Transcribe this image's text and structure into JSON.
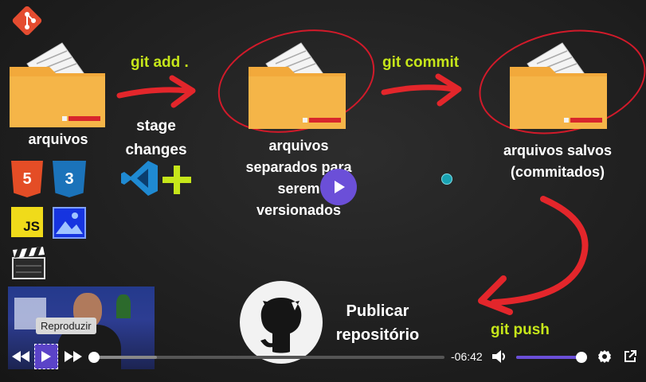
{
  "slide": {
    "label_arquivos": "arquivos",
    "git_add": "git add .",
    "stage_line1": "stage",
    "stage_line2": "changes",
    "separados_line1": "arquivos",
    "separados_line2": "separados para",
    "separados_line3": "serem",
    "separados_line4": "versionados",
    "git_commit": "git commit",
    "salvos_line1": "arquivos salvos",
    "salvos_line2": "(commitados)",
    "publicar_line1": "Publicar",
    "publicar_line2": "repositório",
    "git_push": "git push",
    "html_badge": "5",
    "css_badge": "3",
    "js_badge": "JS"
  },
  "colors": {
    "folder": "#f2a93b",
    "folder_shadow": "#d98e22",
    "red_arrow": "#e3262b",
    "accent_green": "#c6e61a",
    "player_purple": "#6a5acd",
    "play_button": "#6b4fd8"
  },
  "player": {
    "tooltip": "Reproduzir",
    "time_remaining": "-06:42",
    "progress": 0.0,
    "buffered": 0.18,
    "volume": 1.0
  },
  "icons": [
    "git-logo-icon",
    "html5-icon",
    "css3-icon",
    "js-icon",
    "image-icon",
    "clapperboard-icon",
    "vscode-icon",
    "plus-icon",
    "github-octocat-icon",
    "rewind-icon",
    "play-icon",
    "fast-forward-icon",
    "volume-icon",
    "settings-icon",
    "external-link-icon"
  ]
}
